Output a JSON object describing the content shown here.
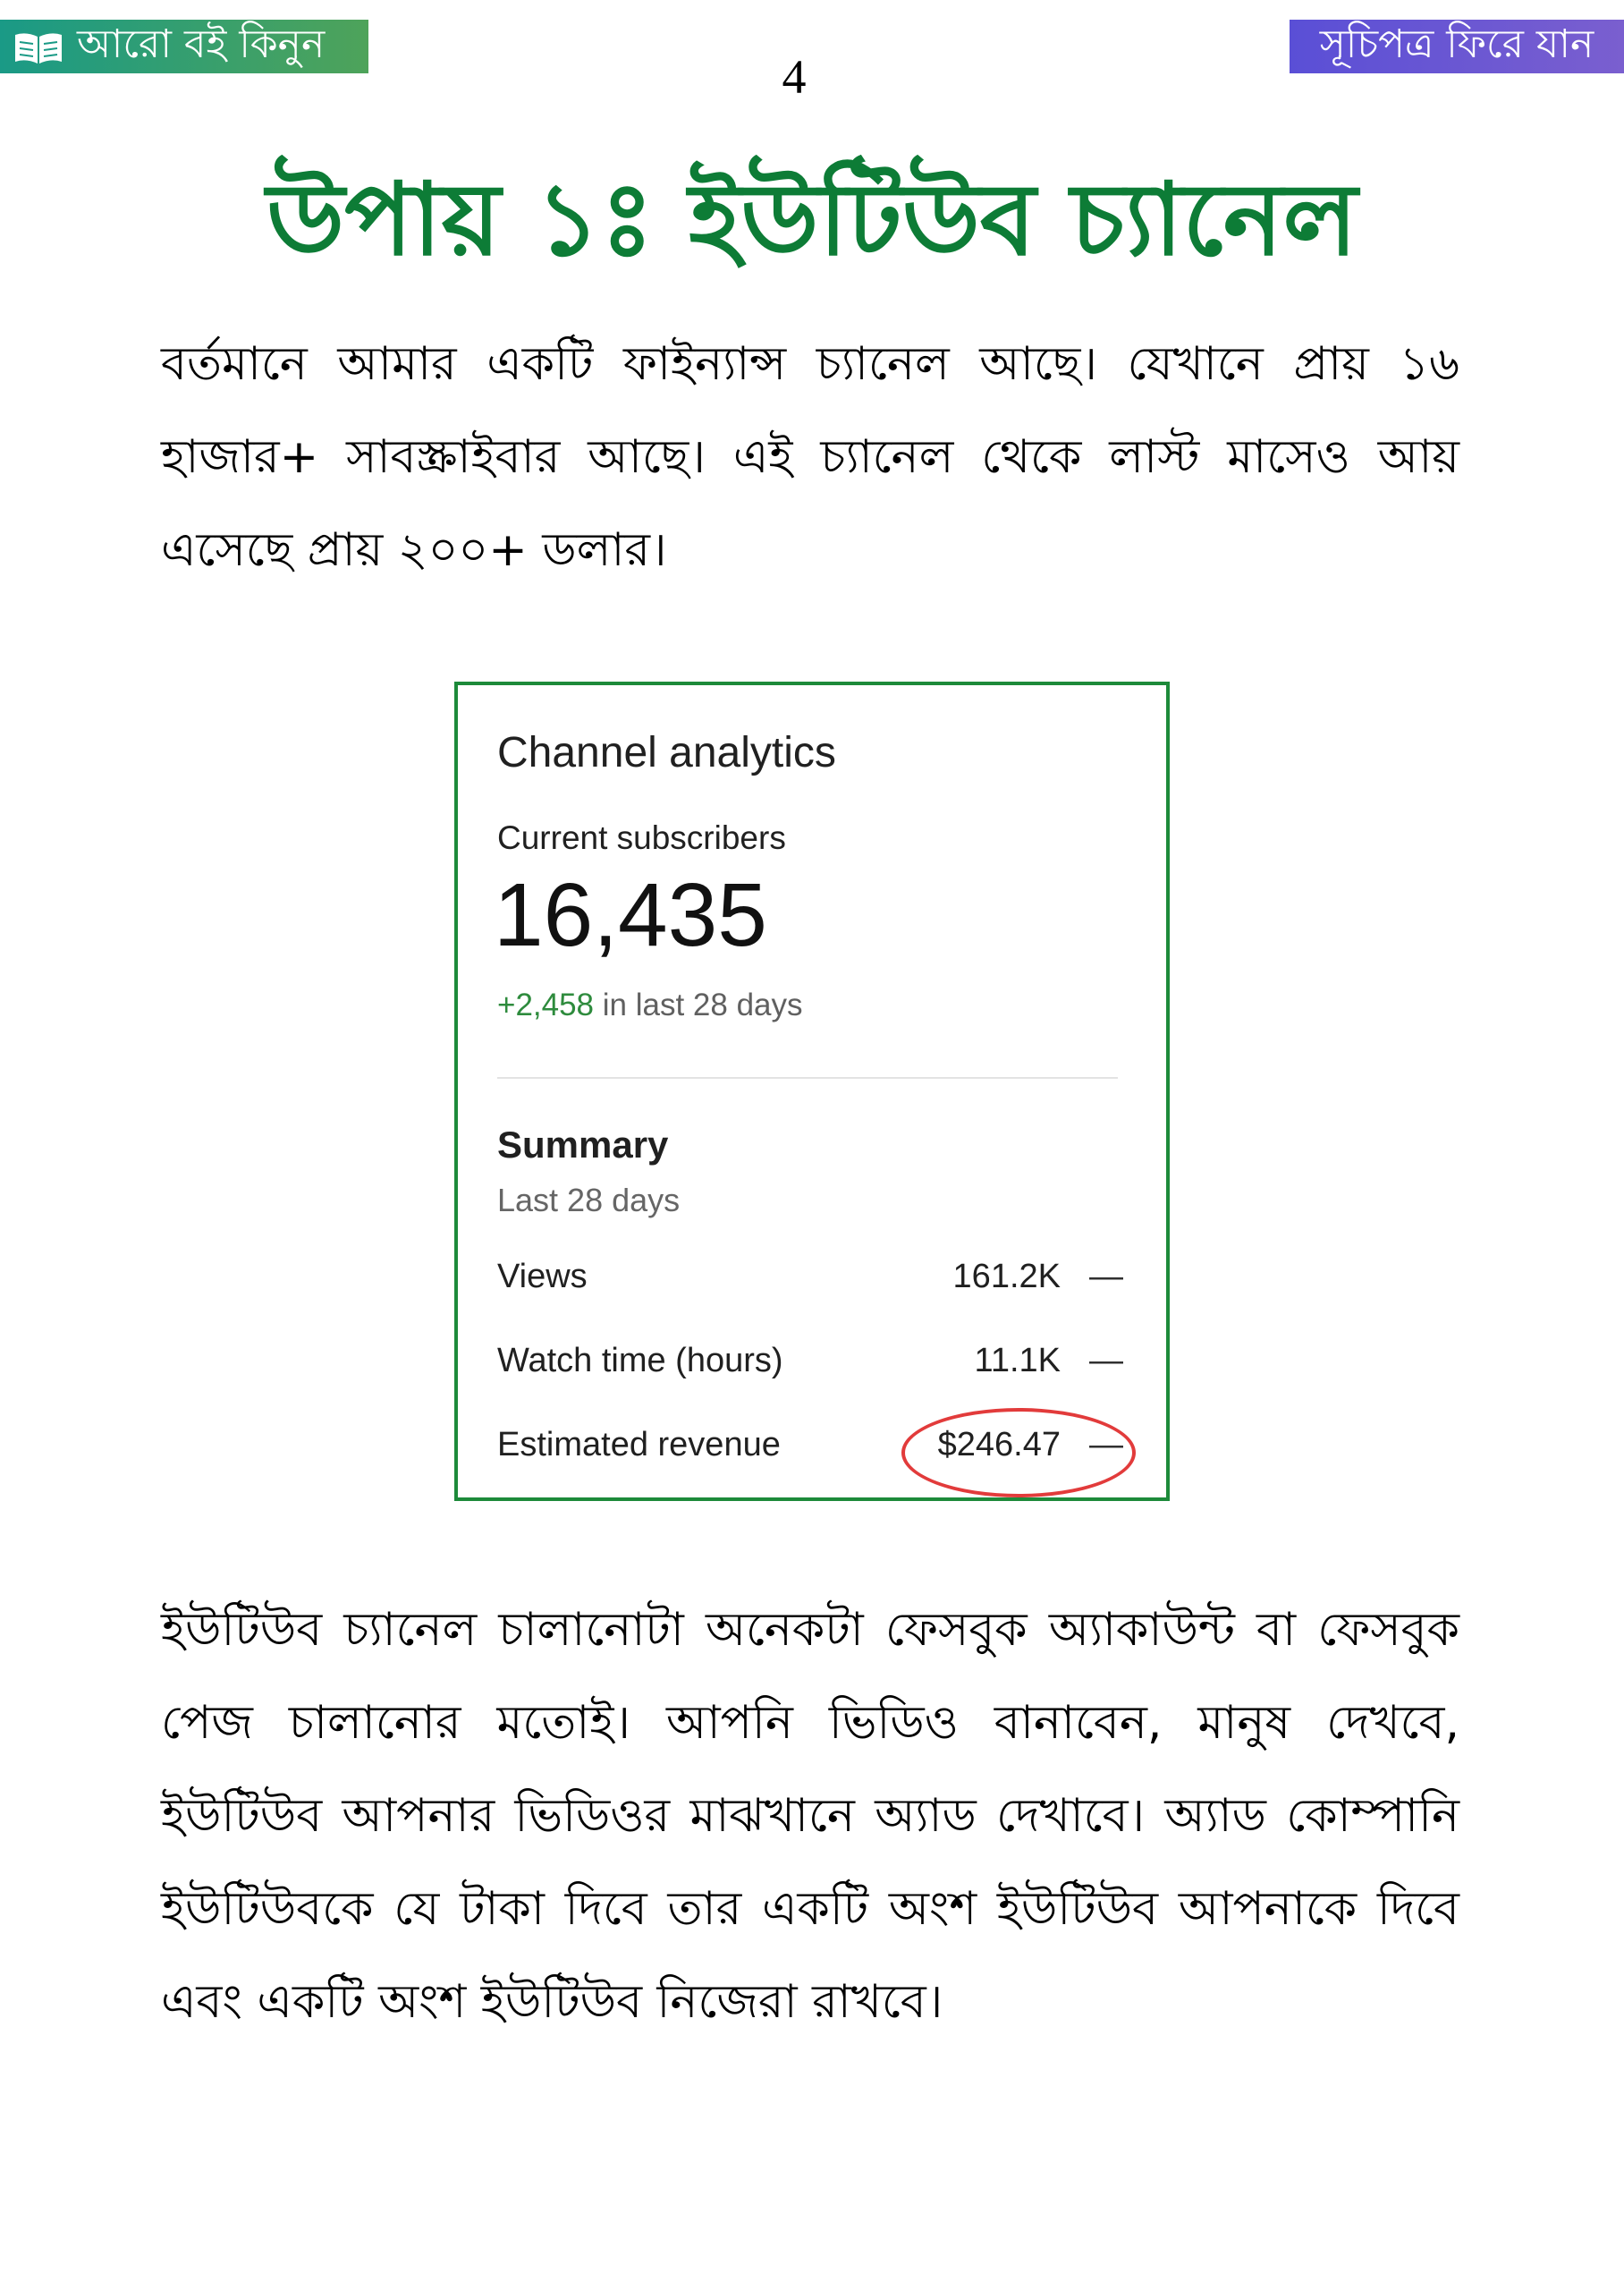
{
  "header": {
    "buy_button_label": "আরো বই কিনুন",
    "toc_button_label": "সূচিপত্র ফিরে যান",
    "page_number": "4"
  },
  "heading": "উপায় ১ঃ ইউটিউব চ্যানেল",
  "paragraphs": [
    "বর্তমানে আমার একটি ফাইন্যান্স চ্যানেল আছে। যেখানে প্রায় ১৬ হাজার+ সাবস্ক্রাইবার আছে। এই চ্যানেল থেকে লাস্ট মাসেও আয় এসেছে প্রায় ২০০+ ডলার।",
    "ইউটিউব চ্যানেল চালানোটা অনেকটা ফেসবুক অ্যাকাউন্ট বা ফেসবুক পেজ চালানোর মতোই। আপনি ভিডিও বানাবেন, মানুষ দেখবে, ইউটিউব আপনার ভিডিওর মাঝখানে অ্যাড দেখাবে। অ্যাড কোম্পানি ইউটিউবকে যে টাকা দিবে তার একটি অংশ ইউটিউব আপনাকে দিবে এবং একটি অংশ ইউটিউব নিজেরা রাখবে।"
  ],
  "analytics": {
    "title": "Channel analytics",
    "subscribers_label": "Current subscribers",
    "subscribers_count": "16,435",
    "growth_value": "+2,458",
    "growth_suffix": " in last 28 days",
    "summary_title": "Summary",
    "summary_period": "Last 28 days",
    "metrics": [
      {
        "label": "Views",
        "value": "161.2K",
        "trend": "—"
      },
      {
        "label": "Watch time (hours)",
        "value": "11.1K",
        "trend": "—"
      },
      {
        "label": "Estimated revenue",
        "value": "$246.47",
        "trend": "—"
      }
    ],
    "highlight_color": "#e23b3b",
    "border_color": "#1d8a3a"
  },
  "colors": {
    "heading": "#0d7c36",
    "buy_button": "#1a9a86",
    "toc_button": "#5a4fd6"
  },
  "icons": {
    "buy_button_icon": "open-book-icon"
  }
}
